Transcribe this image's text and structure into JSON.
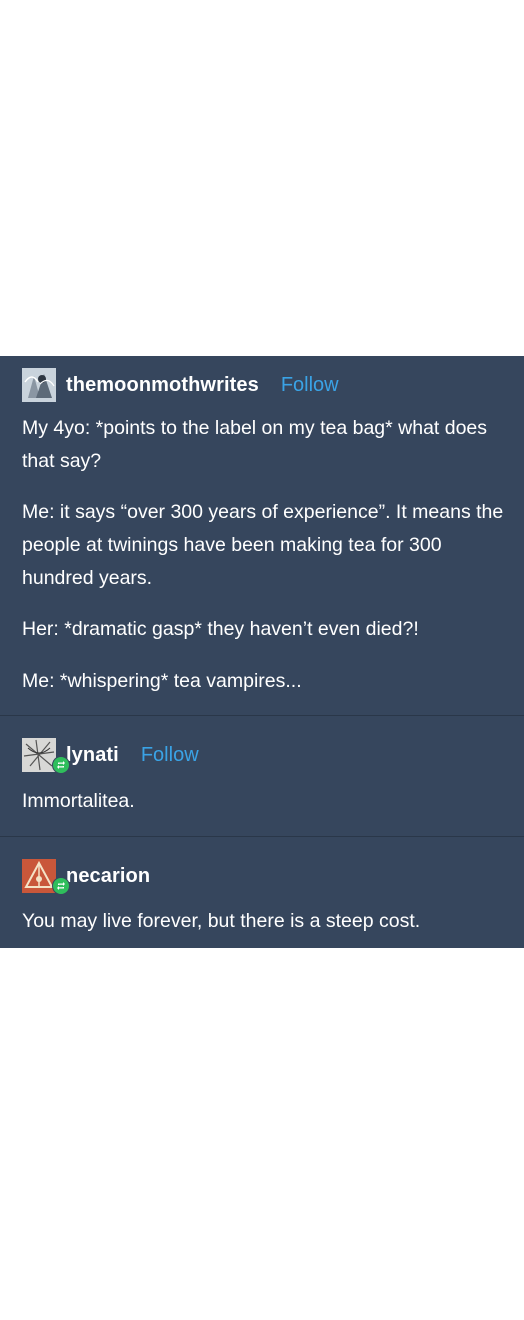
{
  "posts": [
    {
      "username": "themoonmothwrites",
      "follow_label": "Follow",
      "avatar_icon": "fairy-avatar-icon",
      "paragraphs": [
        "My 4yo: *points to the label on my tea bag* what does that say?",
        "Me: it says “over 300 years of experience”. It means the people at twinings have been making tea for 300 hundred years.",
        "Her: *dramatic gasp* they haven’t even died?!",
        "Me: *whispering* tea vampires..."
      ]
    },
    {
      "username": "lynati",
      "follow_label": "Follow",
      "avatar_icon": "sketch-avatar-icon",
      "reblog_icon": "reblog-icon",
      "paragraphs": [
        "Immortalitea."
      ]
    },
    {
      "username": "necarion",
      "avatar_icon": "triangle-avatar-icon",
      "reblog_icon": "reblog-icon",
      "paragraphs": [
        "You may live forever, but there is a steep cost."
      ]
    }
  ],
  "colors": {
    "post_background": "#36465d",
    "follow_link": "#3aa3e6",
    "reblog_badge": "#2fbe5c"
  }
}
